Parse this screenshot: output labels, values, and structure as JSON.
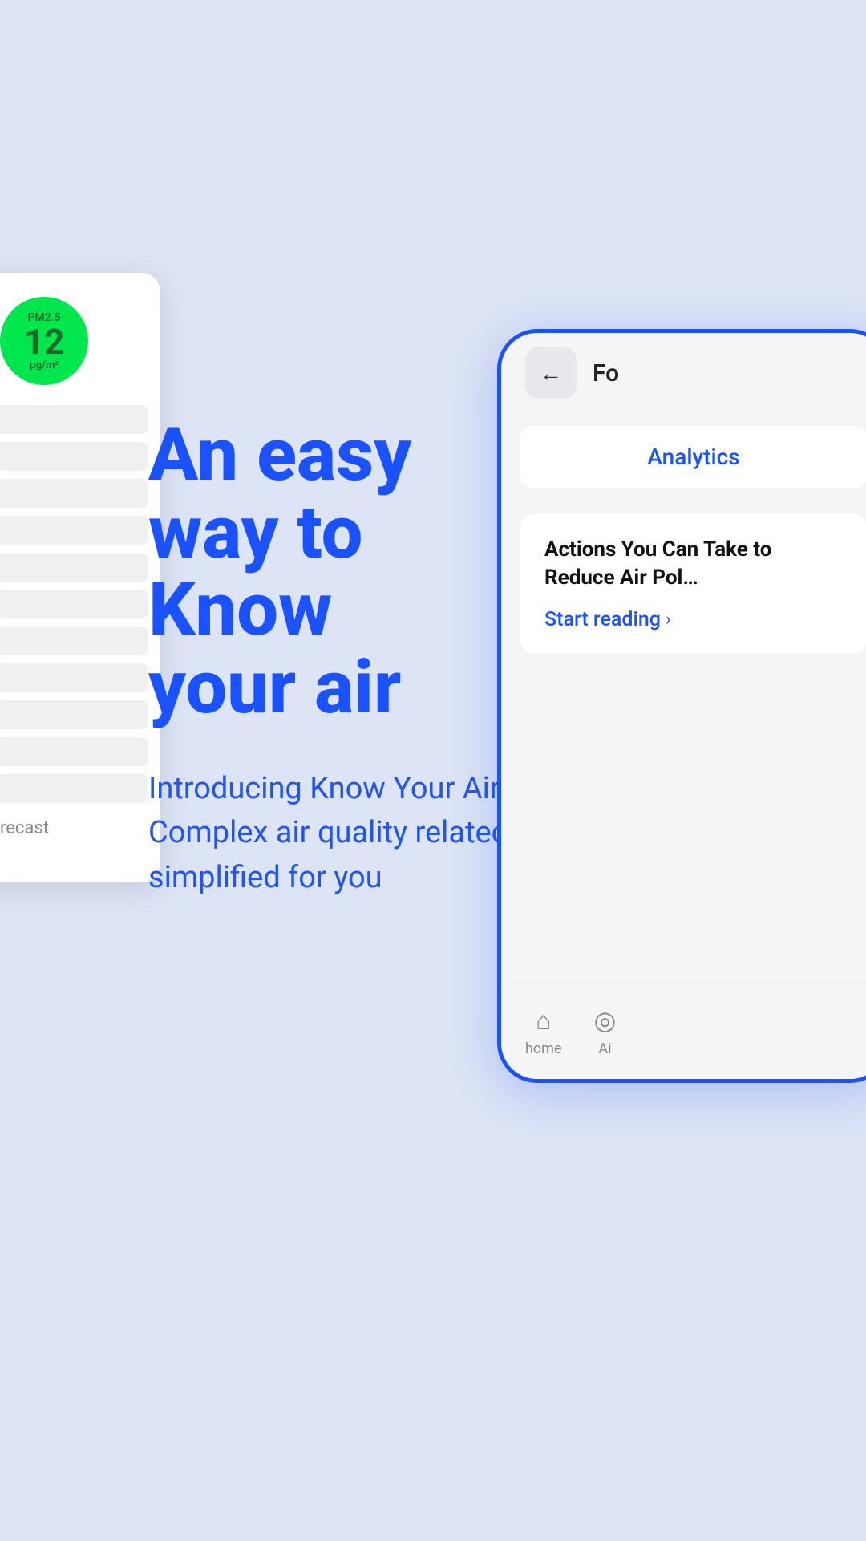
{
  "background_color": "#dde4f5",
  "left_card": {
    "pm_label": "PM2.5",
    "pm_value": "12",
    "pm_unit": "μg/m³",
    "bottom_label": "recast"
  },
  "main_text": {
    "headline_line1": "An easy",
    "headline_line2": "way to",
    "headline_line3": "Know",
    "headline_line4": "your air",
    "subtext": "Introducing Know Your Air. Complex air quality related topics simplified for you"
  },
  "right_phone": {
    "back_button_label": "←",
    "title": "Fo",
    "analytics_tab_label": "Analytics",
    "article": {
      "title": "Actions You Can Take to Reduce Air Pol…",
      "start_reading_label": "Start reading",
      "chevron": "›"
    },
    "bottom_nav": [
      {
        "icon": "⌂",
        "label": "home"
      },
      {
        "icon": "◎",
        "label": "Ai"
      }
    ]
  }
}
